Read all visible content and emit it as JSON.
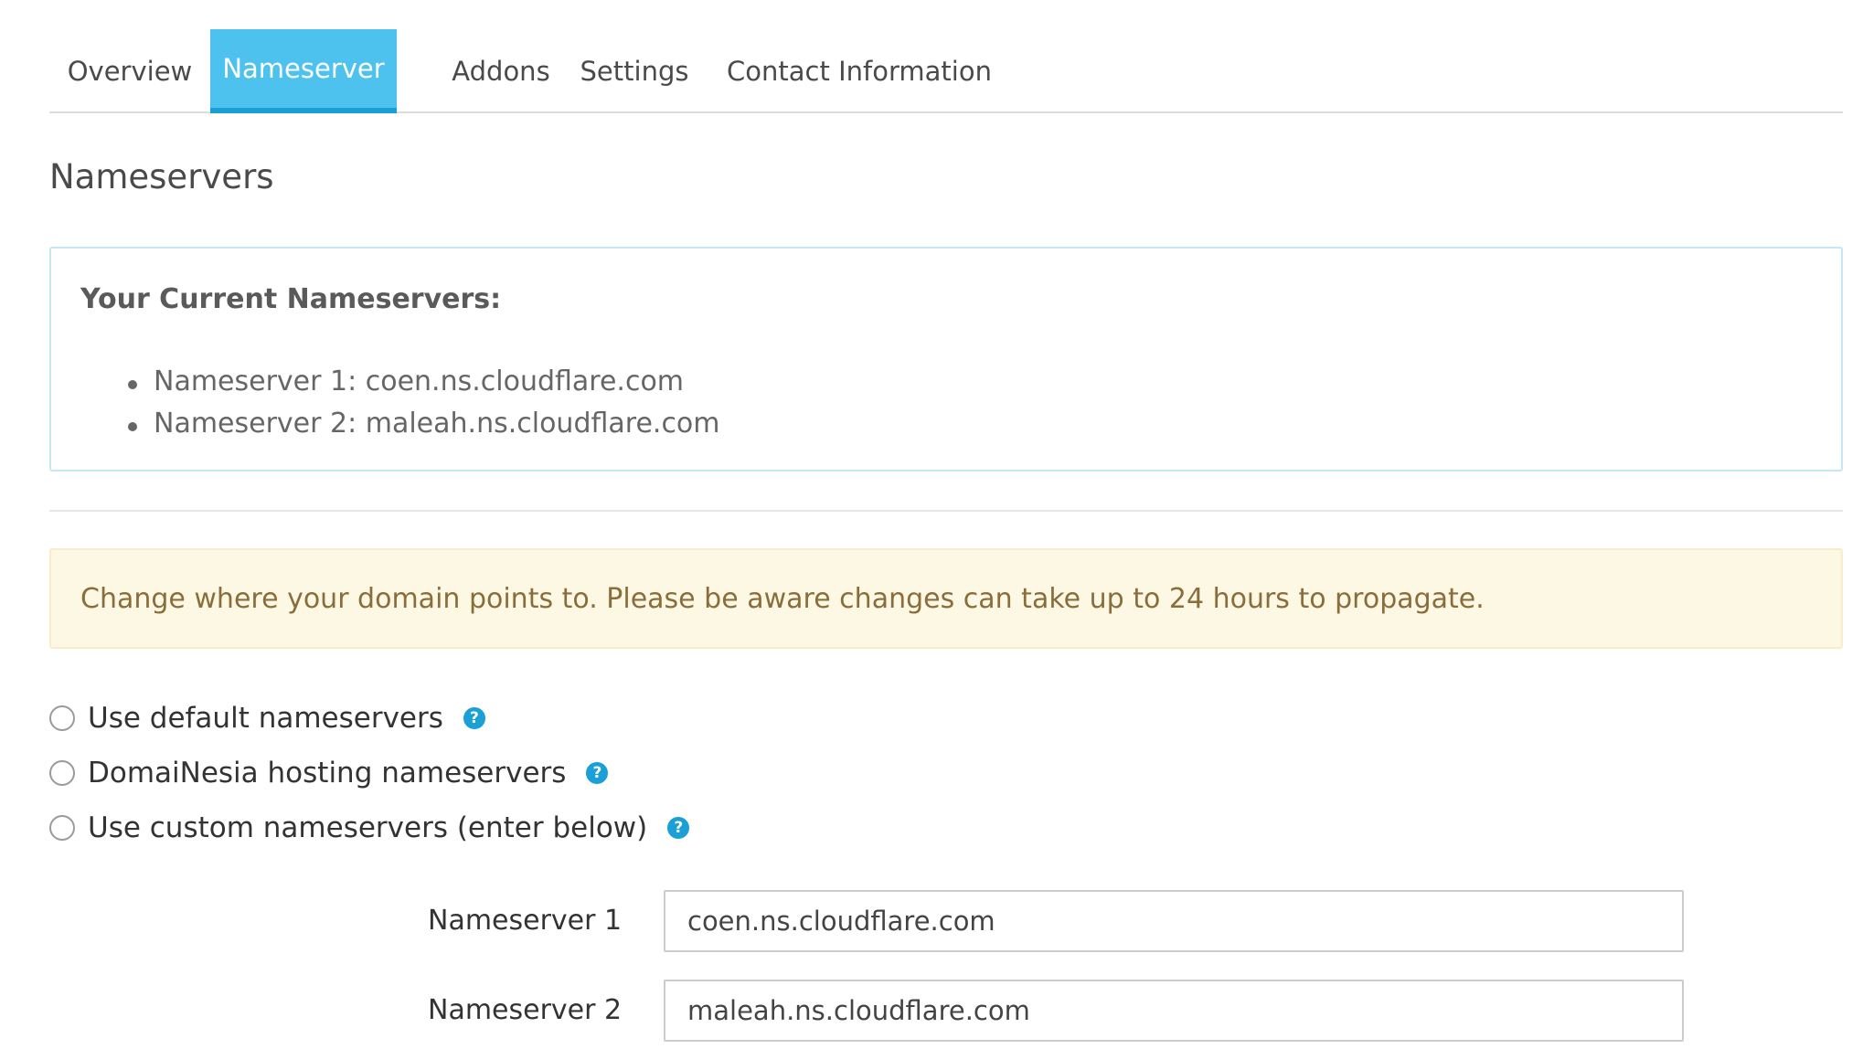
{
  "tabs": [
    {
      "label": "Overview",
      "active": false
    },
    {
      "label": "Nameserver",
      "active": true
    },
    {
      "label": "Addons",
      "active": false
    },
    {
      "label": "Settings",
      "active": false
    },
    {
      "label": "Contact Information",
      "active": false
    }
  ],
  "page_title": "Nameservers",
  "current_nameservers": {
    "title": "Your Current Nameservers:",
    "items": [
      "Nameserver 1: coen.ns.cloudflare.com",
      "Nameserver 2: maleah.ns.cloudflare.com"
    ]
  },
  "alert": {
    "text": "Change where your domain points to. Please be aware changes can take up to 24 hours to propagate."
  },
  "options": [
    {
      "label": "Use default nameservers",
      "checked": false,
      "help_icon": "question-circle-icon"
    },
    {
      "label": "DomaiNesia hosting nameservers",
      "checked": false,
      "help_icon": "question-circle-icon"
    },
    {
      "label": "Use custom nameservers (enter below)",
      "checked": false,
      "help_icon": "question-circle-icon"
    }
  ],
  "fields": [
    {
      "label": "Nameserver 1",
      "value": "coen.ns.cloudflare.com"
    },
    {
      "label": "Nameserver 2",
      "value": "maleah.ns.cloudflare.com"
    }
  ],
  "colors": {
    "tab_active_bg": "#4dc2ef",
    "tab_active_border": "#1a9fd6",
    "alert_bg": "#fcf8e3",
    "alert_text": "#8a6d3b",
    "info_border": "#c5e6f3",
    "help_icon": "#1a9fd6"
  },
  "help_icon_glyph": "?"
}
